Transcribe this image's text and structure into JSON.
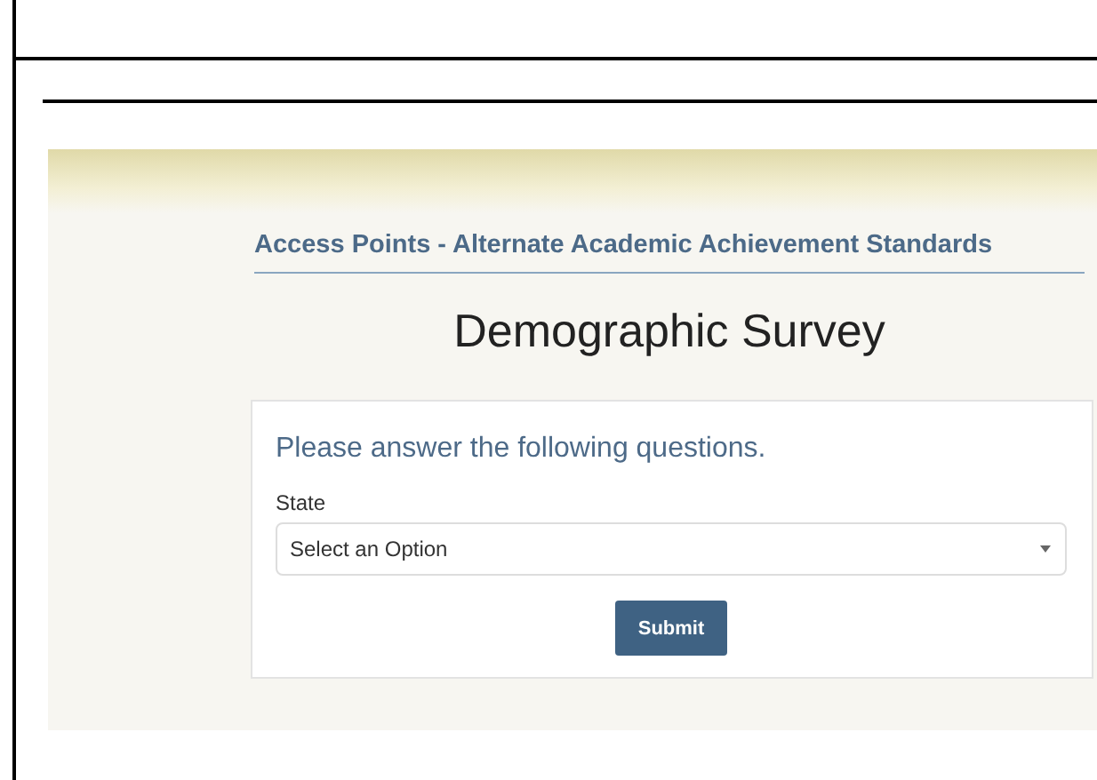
{
  "header": {
    "title": "Access Points - Alternate Academic Achievement Standards"
  },
  "survey": {
    "title": "Demographic Survey"
  },
  "form": {
    "prompt": "Please answer the following questions.",
    "fields": [
      {
        "kind": "select",
        "label": "State",
        "placeholder": "Select an Option"
      }
    ],
    "buttons": [
      "Submit"
    ]
  }
}
